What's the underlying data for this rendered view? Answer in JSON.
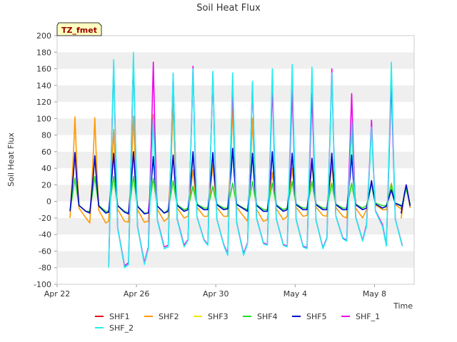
{
  "chart_data": {
    "type": "line",
    "title": "Soil Heat Flux",
    "xlabel": "Time",
    "ylabel": "Soil Heat Flux",
    "badge": "TZ_fmet",
    "ylim": [
      -100,
      200
    ],
    "xlim": [
      0,
      18
    ],
    "yticks": [
      -100,
      -80,
      -60,
      -40,
      -20,
      0,
      20,
      40,
      60,
      80,
      100,
      120,
      140,
      160,
      180,
      200
    ],
    "xticks": [
      {
        "x": 0,
        "label": "Apr 22"
      },
      {
        "x": 4,
        "label": "Apr 26"
      },
      {
        "x": 8,
        "label": "Apr 30"
      },
      {
        "x": 12,
        "label": "May 4"
      },
      {
        "x": 16,
        "label": "May 8"
      }
    ],
    "grid": "horizontal bands",
    "legend_position": "bottom",
    "series": [
      {
        "name": "SHF1",
        "color": "#e8101a"
      },
      {
        "name": "SHF2",
        "color": "#ff9a00"
      },
      {
        "name": "SHF3",
        "color": "#f2e600"
      },
      {
        "name": "SHF4",
        "color": "#22dd22"
      },
      {
        "name": "SHF5",
        "color": "#0000cc"
      },
      {
        "name": "SHF_1",
        "color": "#ee00ee"
      },
      {
        "name": "SHF_2",
        "color": "#22eeee"
      }
    ],
    "daily_peaks": {
      "SHF2": [
        {
          "day": 0.9,
          "peak": 102,
          "min": -20
        },
        {
          "day": 1.9,
          "peak": 101,
          "min": -26
        },
        {
          "day": 2.85,
          "peak": 87,
          "min": -24
        },
        {
          "day": 3.85,
          "peak": 103,
          "min": -25
        },
        {
          "day": 4.85,
          "peak": 105,
          "min": -24
        },
        {
          "day": 5.85,
          "peak": 118,
          "min": -20
        },
        {
          "day": 6.85,
          "peak": 38,
          "min": -18
        },
        {
          "day": 7.85,
          "peak": 44,
          "min": -18
        },
        {
          "day": 8.85,
          "peak": 113,
          "min": -18
        },
        {
          "day": 9.85,
          "peak": 100,
          "min": -24
        },
        {
          "day": 10.85,
          "peak": 35,
          "min": -22
        },
        {
          "day": 11.85,
          "peak": 40,
          "min": -18
        },
        {
          "day": 12.85,
          "peak": 46,
          "min": -17
        },
        {
          "day": 13.85,
          "peak": 46,
          "min": -18
        },
        {
          "day": 14.85,
          "peak": 88,
          "min": -20
        },
        {
          "day": 15.85,
          "peak": 25,
          "min": -10
        },
        {
          "day": 16.85,
          "peak": 22,
          "min": -10
        },
        {
          "day": 17.6,
          "peak": 18,
          "min": -20
        }
      ],
      "SHF4": [
        {
          "day": 0.9,
          "peak": 28,
          "min": -12
        },
        {
          "day": 1.9,
          "peak": 30,
          "min": -12
        },
        {
          "day": 2.85,
          "peak": 30,
          "min": -12
        },
        {
          "day": 3.85,
          "peak": 30,
          "min": -14
        },
        {
          "day": 4.85,
          "peak": 28,
          "min": -14
        },
        {
          "day": 5.85,
          "peak": 25,
          "min": -10
        },
        {
          "day": 6.85,
          "peak": 18,
          "min": -8
        },
        {
          "day": 7.85,
          "peak": 18,
          "min": -8
        },
        {
          "day": 8.85,
          "peak": 22,
          "min": -8
        },
        {
          "day": 9.85,
          "peak": 24,
          "min": -10
        },
        {
          "day": 10.85,
          "peak": 22,
          "min": -10
        },
        {
          "day": 11.85,
          "peak": 24,
          "min": -8
        },
        {
          "day": 12.85,
          "peak": 24,
          "min": -8
        },
        {
          "day": 13.85,
          "peak": 22,
          "min": -8
        },
        {
          "day": 14.85,
          "peak": 22,
          "min": -8
        },
        {
          "day": 15.85,
          "peak": 22,
          "min": -5
        },
        {
          "day": 16.85,
          "peak": 20,
          "min": -5
        },
        {
          "day": 17.6,
          "peak": 15,
          "min": -8
        }
      ],
      "SHF5": [
        {
          "day": 0.9,
          "peak": 59,
          "min": -12
        },
        {
          "day": 1.9,
          "peak": 55,
          "min": -14
        },
        {
          "day": 2.85,
          "peak": 58,
          "min": -13
        },
        {
          "day": 3.85,
          "peak": 60,
          "min": -15
        },
        {
          "day": 4.85,
          "peak": 54,
          "min": -14
        },
        {
          "day": 5.85,
          "peak": 56,
          "min": -12
        },
        {
          "day": 6.85,
          "peak": 60,
          "min": -10
        },
        {
          "day": 7.85,
          "peak": 59,
          "min": -10
        },
        {
          "day": 8.85,
          "peak": 64,
          "min": -9
        },
        {
          "day": 9.85,
          "peak": 58,
          "min": -12
        },
        {
          "day": 10.85,
          "peak": 60,
          "min": -12
        },
        {
          "day": 11.85,
          "peak": 58,
          "min": -10
        },
        {
          "day": 12.85,
          "peak": 52,
          "min": -10
        },
        {
          "day": 13.85,
          "peak": 58,
          "min": -10
        },
        {
          "day": 14.85,
          "peak": 56,
          "min": -10
        },
        {
          "day": 15.85,
          "peak": 25,
          "min": -8
        },
        {
          "day": 16.85,
          "peak": 14,
          "min": -6
        },
        {
          "day": 17.6,
          "peak": 20,
          "min": -14
        }
      ],
      "SHF_2": [
        {
          "day": 2.85,
          "peak": 171,
          "min": -80
        },
        {
          "day": 3.85,
          "peak": 180,
          "min": -76
        },
        {
          "day": 4.85,
          "peak": 99,
          "min": -57
        },
        {
          "day": 5.85,
          "peak": 155,
          "min": -55
        },
        {
          "day": 6.85,
          "peak": 160,
          "min": -47
        },
        {
          "day": 7.85,
          "peak": 157,
          "min": -53
        },
        {
          "day": 8.85,
          "peak": 155,
          "min": -65
        },
        {
          "day": 9.85,
          "peak": 145,
          "min": -51
        },
        {
          "day": 10.85,
          "peak": 160,
          "min": -53
        },
        {
          "day": 11.85,
          "peak": 165,
          "min": -55
        },
        {
          "day": 12.85,
          "peak": 162,
          "min": -57
        },
        {
          "day": 13.85,
          "peak": 155,
          "min": -45
        },
        {
          "day": 14.85,
          "peak": 95,
          "min": -48
        },
        {
          "day": 15.85,
          "peak": 90,
          "min": -30
        },
        {
          "day": 16.85,
          "peak": 168,
          "min": -54
        }
      ],
      "SHF_1": [
        {
          "day": 2.85,
          "peak": 165,
          "min": -78
        },
        {
          "day": 3.85,
          "peak": 172,
          "min": -74
        },
        {
          "day": 4.85,
          "peak": 168,
          "min": -55
        },
        {
          "day": 5.85,
          "peak": 153,
          "min": -53
        },
        {
          "day": 6.85,
          "peak": 163,
          "min": -46
        },
        {
          "day": 7.85,
          "peak": 155,
          "min": -52
        },
        {
          "day": 8.85,
          "peak": 140,
          "min": -63
        },
        {
          "day": 9.85,
          "peak": 143,
          "min": -50
        },
        {
          "day": 10.85,
          "peak": 140,
          "min": -52
        },
        {
          "day": 11.85,
          "peak": 135,
          "min": -54
        },
        {
          "day": 12.85,
          "peak": 130,
          "min": -56
        },
        {
          "day": 13.85,
          "peak": 160,
          "min": -44
        },
        {
          "day": 14.85,
          "peak": 130,
          "min": -47
        },
        {
          "day": 15.85,
          "peak": 98,
          "min": -28
        },
        {
          "day": 16.85,
          "peak": 145,
          "min": -53
        }
      ]
    }
  }
}
